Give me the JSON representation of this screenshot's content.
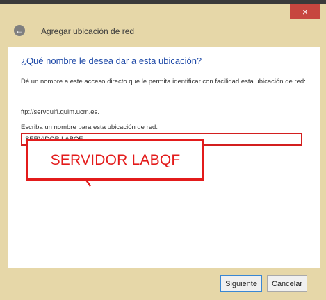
{
  "window": {
    "close_glyph": "×",
    "back_glyph": "←",
    "title": "Agregar ubicación de red"
  },
  "content": {
    "question": "¿Qué nombre le desea dar a esta ubicación?",
    "description": "Dé un nombre a este acceso directo que le permita identificar con facilidad esta ubicación de red:",
    "url": "ftp://servquifi.quim.ucm.es.",
    "input_label": "Escriba un nombre para esta ubicación de red:",
    "input_value": "SERVIDOR LABQF"
  },
  "annotation": {
    "text": "SERVIDOR LABQF",
    "color": "#e31b1b"
  },
  "buttons": {
    "next": "Siguiente",
    "cancel": "Cancelar"
  },
  "colors": {
    "frame": "#e6d7a8",
    "close": "#c7463f",
    "heading": "#1f4aa8"
  }
}
